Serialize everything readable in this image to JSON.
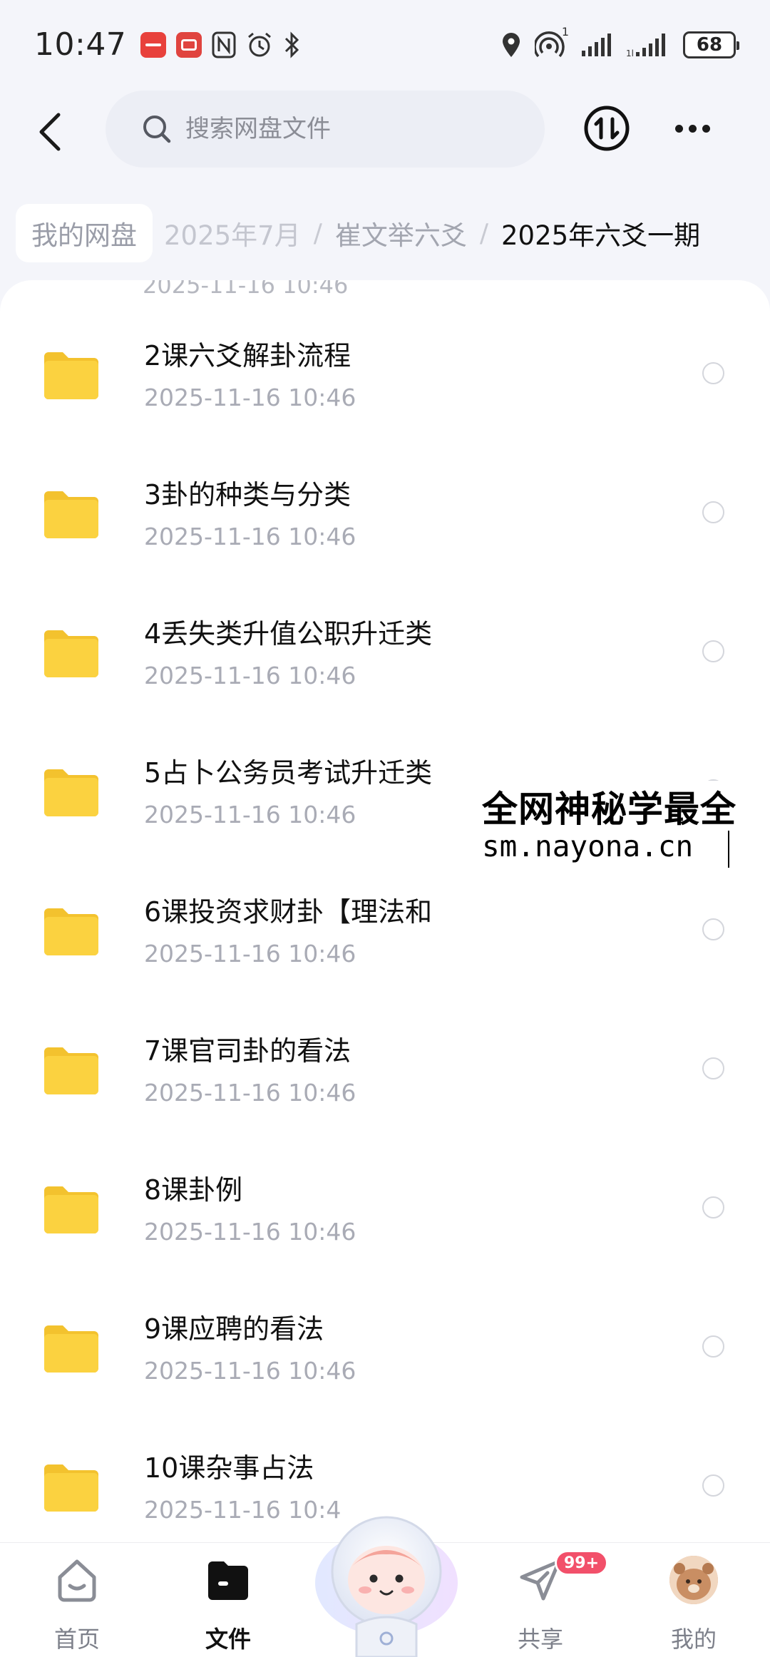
{
  "status_bar": {
    "time": "10:47",
    "battery": "68",
    "hotspot_count": "1",
    "icons": [
      "app-icon",
      "app-icon",
      "nfc-icon",
      "alarm-icon",
      "bluetooth-icon",
      "location-icon",
      "hotspot-icon",
      "signal-icon",
      "signal-icon",
      "battery-icon"
    ]
  },
  "header": {
    "search_placeholder": "搜索网盘文件",
    "icons": [
      "back-icon",
      "search-icon",
      "transfer-icon",
      "more-icon"
    ]
  },
  "breadcrumb": [
    "我的网盘",
    "2025年7月",
    "崔文举六爻",
    "2025年六爻一期"
  ],
  "partial_row_date": "2025-11-16 10:46",
  "files": [
    {
      "name": "2课六爻解卦流程",
      "date": "2025-11-16  10:46"
    },
    {
      "name": "3卦的种类与分类",
      "date": "2025-11-16  10:46"
    },
    {
      "name": "4丢失类升值公职升迁类",
      "date": "2025-11-16  10:46"
    },
    {
      "name": "5占卜公务员考试升迁类",
      "date": "2025-11-16  10:46"
    },
    {
      "name": "6课投资求财卦【理法和",
      "date": "2025-11-16  10:46"
    },
    {
      "name": "7课官司卦的看法",
      "date": "2025-11-16  10:46"
    },
    {
      "name": "8课卦例",
      "date": "2025-11-16  10:46"
    },
    {
      "name": "9课应聘的看法",
      "date": "2025-11-16  10:46"
    },
    {
      "name": "10课杂事占法",
      "date": "2025-11-16  10:4"
    }
  ],
  "watermark": {
    "line1": "全网神秘学最全",
    "line2": "sm.nayona.cn"
  },
  "bottom_nav": {
    "home": "首页",
    "files": "文件",
    "share": "共享",
    "share_badge": "99+",
    "me": "我的"
  },
  "colors": {
    "folder": "#fbd240",
    "badge": "#f2506a",
    "background": "#f4f5fa"
  }
}
